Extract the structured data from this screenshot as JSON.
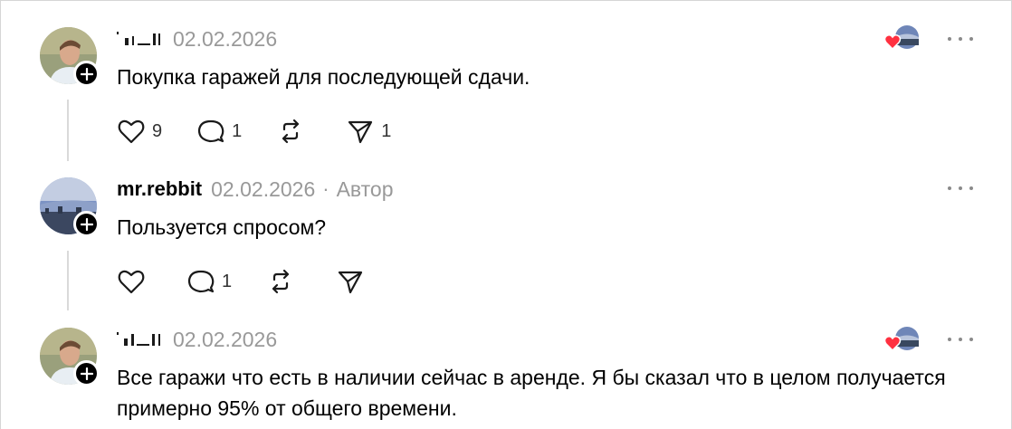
{
  "posts": [
    {
      "username": "",
      "date": "02.02.2026",
      "text": "Покупка гаражей для последующей сдачи.",
      "likes": "9",
      "comments": "1",
      "reposts": "",
      "shares": "1"
    },
    {
      "username": "mr.rebbit",
      "date": "02.02.2026",
      "separator": "·",
      "author_label": "Автор",
      "text": "Пользуется спросом?",
      "likes": "",
      "comments": "1",
      "reposts": "",
      "shares": ""
    },
    {
      "username": "",
      "date": "02.02.2026",
      "text": "Все гаражи что есть в наличии сейчас в аренде. Я бы сказал что в целом получается примерно 95% от общего времени."
    }
  ],
  "icons": {
    "like": "heart-icon",
    "comment": "comment-icon",
    "repost": "repost-icon",
    "share": "share-icon",
    "more": "more-icon",
    "follow": "plus-icon"
  },
  "colors": {
    "liked_heart": "#ff3040",
    "meta_gray": "#999999",
    "thread_line": "#d9d9d9"
  }
}
